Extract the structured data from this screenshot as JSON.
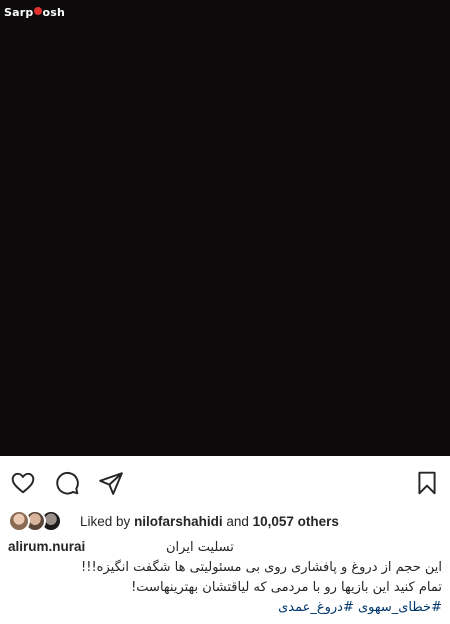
{
  "watermark": {
    "brand_prefix": "Sarp",
    "brand_suffix": "sh"
  },
  "post": {
    "liked_by_prefix": "Liked by",
    "liked_by_user": "nilofarshahidi",
    "liked_by_and": "and",
    "likes_count": "10,057 others",
    "caption_username": "alirum.nurai",
    "caption_line1": "تسلیت ایران",
    "caption_line2": "این حجم از دروغ و پافشاری روی بی مسئولیتی ها شگفت انگیزه!!!",
    "caption_line3": "تمام کنید این بازیها رو با مردمی که لیاقتشان بهترینهاست!",
    "hashtag1": "#خطای_سهوی",
    "hashtag2": "#دروغ_عمدی"
  },
  "icons": [
    "heart-icon",
    "comment-icon",
    "share-icon",
    "bookmark-icon"
  ],
  "colors": {
    "image_bg": "#0c0a0a",
    "hashtag": "#00376b",
    "text": "#262626"
  }
}
